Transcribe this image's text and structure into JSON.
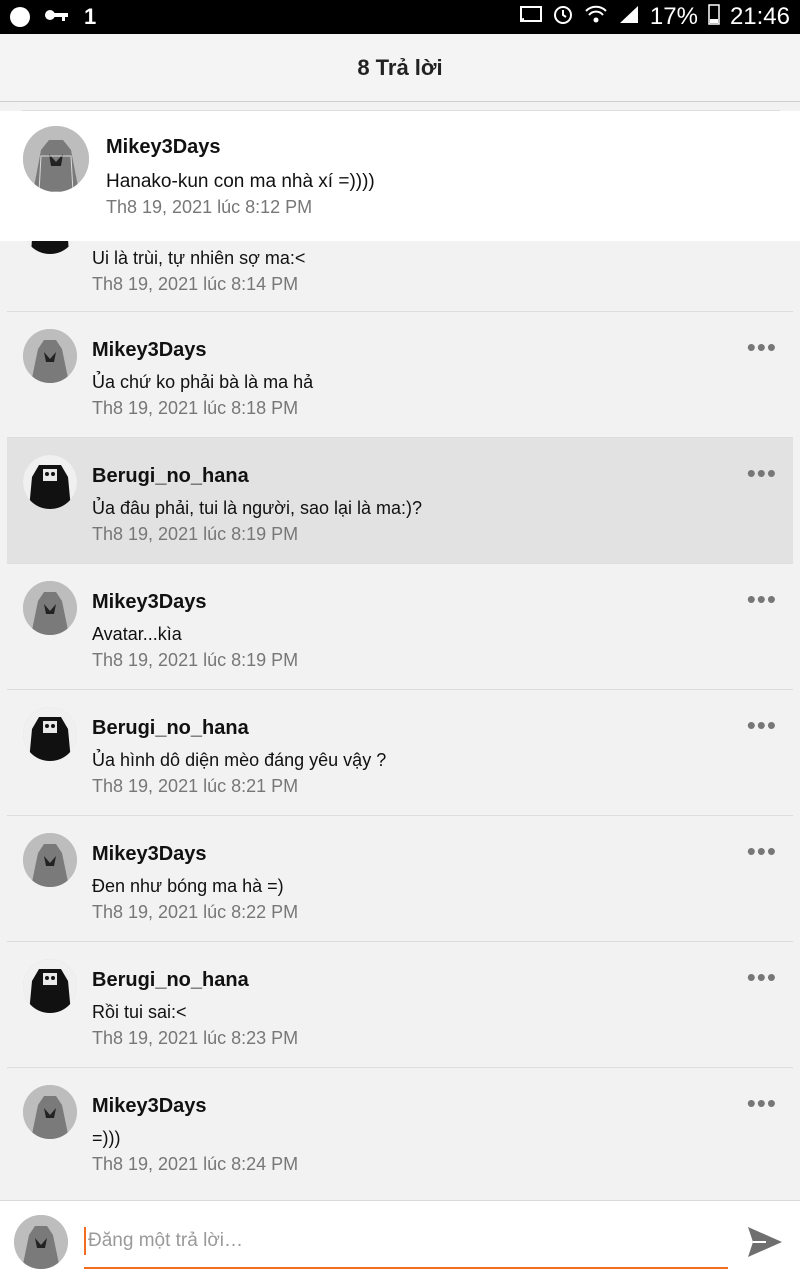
{
  "status_bar": {
    "notification_count": "1",
    "battery": "17%",
    "time": "21:46"
  },
  "header": {
    "title": "8 Trả lời"
  },
  "parent_comment": {
    "author": "Mikey3Days",
    "message": "Hanako-kun con ma nhà xí =))))",
    "time": "Th8 19, 2021 lúc 8:12 PM"
  },
  "replies": [
    {
      "author": "",
      "message": "Ui là trùi, tự nhiên sợ ma:<",
      "time": "Th8 19, 2021 lúc 8:14 PM",
      "avatar": "cat-avatar"
    },
    {
      "author": "Mikey3Days",
      "message": "Ủa chứ ko phải bà là ma hả",
      "time": "Th8 19, 2021 lúc 8:18 PM",
      "avatar": "ghost-avatar"
    },
    {
      "author": "Berugi_no_hana",
      "message": "Ủa đâu phải, tui là người, sao lại là ma:)?",
      "time": "Th8 19, 2021 lúc 8:19 PM",
      "avatar": "cat-avatar"
    },
    {
      "author": "Mikey3Days",
      "message": "Avatar...kìa",
      "time": "Th8 19, 2021 lúc 8:19 PM",
      "avatar": "ghost-avatar"
    },
    {
      "author": "Berugi_no_hana",
      "message": "Ủa hình dô diện mèo đáng yêu vậy ?",
      "time": "Th8 19, 2021 lúc 8:21 PM",
      "avatar": "cat-avatar"
    },
    {
      "author": "Mikey3Days",
      "message": "Đen như bóng ma hà =)",
      "time": "Th8 19, 2021 lúc 8:22 PM",
      "avatar": "ghost-avatar"
    },
    {
      "author": "Berugi_no_hana",
      "message": "Rồi tui sai:<",
      "time": "Th8 19, 2021 lúc 8:23 PM",
      "avatar": "cat-avatar"
    },
    {
      "author": "Mikey3Days",
      "message": "=)))",
      "time": "Th8 19, 2021 lúc 8:24 PM",
      "avatar": "ghost-avatar"
    }
  ],
  "composer": {
    "placeholder": "Đăng một trả lời…"
  },
  "colors": {
    "accent": "#f36d21",
    "highlight": "#e2e2e2"
  }
}
